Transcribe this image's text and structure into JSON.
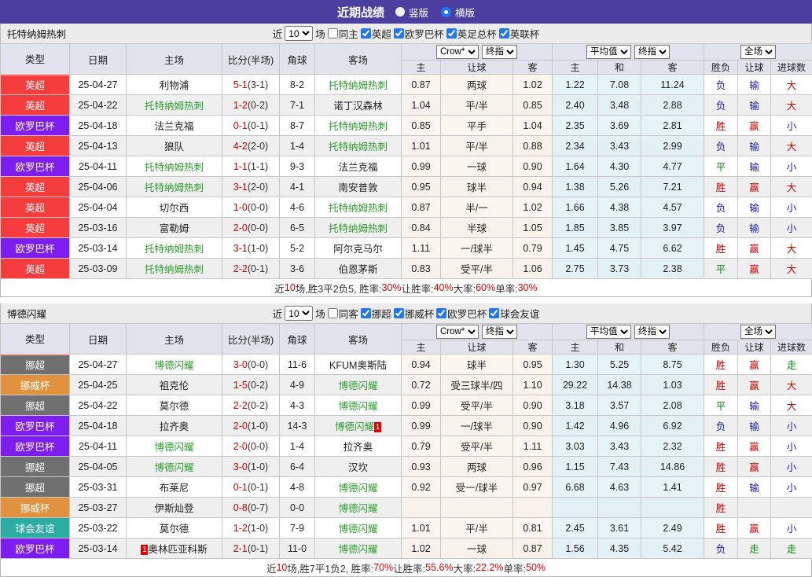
{
  "title_bar": {
    "title": "近期战绩",
    "options": [
      {
        "label": "竖版",
        "selected": false
      },
      {
        "label": "横版",
        "selected": true
      }
    ]
  },
  "columns": {
    "type": "类型",
    "date": "日期",
    "home": "主场",
    "score": "比分(半场)",
    "corner": "角球",
    "away": "客场",
    "bookmaker_select": "Crow*",
    "final_select": "终指",
    "avg_select": "平均值",
    "scope_select": "全场",
    "odds_home": "主",
    "odds_line": "让球",
    "odds_away": "客",
    "avg_home": "主",
    "avg_draw": "和",
    "avg_away": "客",
    "result_wl": "胜负",
    "result_handicap": "让球",
    "result_goals": "进球数"
  },
  "league_colors": {
    "英超": "#f53d3d",
    "欧罗巴杯": "#7d1df0",
    "挪超": "#707070",
    "挪威杯": "#e0923f",
    "球会友谊": "#2bada2"
  },
  "outcome_colors": {
    "胜": "#d40000",
    "负": "#1a1ab8",
    "平": "#0a8a0a",
    "赢": "#d40000",
    "输": "#1a1ab8",
    "走": "#0a8a0a",
    "大": "#d40000",
    "小": "#1a1ab8"
  },
  "sections": [
    {
      "team": "托特纳姆热刺",
      "filter": {
        "near_label": "近",
        "games_value": "10",
        "games_label": "场",
        "same_label": "同主",
        "same_checked": false,
        "leagues": [
          {
            "label": "英超",
            "checked": true
          },
          {
            "label": "欧罗巴杯",
            "checked": true
          },
          {
            "label": "英足总杯",
            "checked": true
          },
          {
            "label": "英联杯",
            "checked": true
          }
        ]
      },
      "rows": [
        {
          "type": "英超",
          "date": "25-04-27",
          "home": {
            "name": "利物浦",
            "self": false
          },
          "score": "5-1",
          "half": "(3-1)",
          "corner": "8-2",
          "away": {
            "name": "托特纳姆热刺",
            "self": true
          },
          "odds": [
            "0.87",
            "两球",
            "1.02"
          ],
          "avg": [
            "1.22",
            "7.08",
            "11.24"
          ],
          "results": [
            "负",
            "输",
            "大"
          ]
        },
        {
          "type": "英超",
          "date": "25-04-22",
          "home": {
            "name": "托特纳姆热刺",
            "self": true
          },
          "score": "1-2",
          "half": "(0-2)",
          "corner": "7-1",
          "away": {
            "name": "诺丁汉森林",
            "self": false
          },
          "odds": [
            "1.04",
            "平/半",
            "0.85"
          ],
          "avg": [
            "2.40",
            "3.48",
            "2.88"
          ],
          "results": [
            "负",
            "输",
            "大"
          ]
        },
        {
          "type": "欧罗巴杯",
          "date": "25-04-18",
          "home": {
            "name": "法兰克福",
            "self": false
          },
          "score": "0-1",
          "half": "(0-1)",
          "corner": "8-7",
          "away": {
            "name": "托特纳姆热刺",
            "self": true
          },
          "odds": [
            "0.85",
            "平手",
            "1.04"
          ],
          "avg": [
            "2.35",
            "3.69",
            "2.81"
          ],
          "results": [
            "胜",
            "赢",
            "小"
          ]
        },
        {
          "type": "英超",
          "date": "25-04-13",
          "home": {
            "name": "狼队",
            "self": false
          },
          "score": "4-2",
          "half": "(2-0)",
          "corner": "1-4",
          "away": {
            "name": "托特纳姆热刺",
            "self": true
          },
          "odds": [
            "1.01",
            "平/半",
            "0.88"
          ],
          "avg": [
            "2.34",
            "3.43",
            "2.99"
          ],
          "results": [
            "负",
            "输",
            "大"
          ]
        },
        {
          "type": "欧罗巴杯",
          "date": "25-04-11",
          "home": {
            "name": "托特纳姆热刺",
            "self": true
          },
          "score": "1-1",
          "half": "(1-1)",
          "corner": "9-3",
          "away": {
            "name": "法兰克福",
            "self": false
          },
          "odds": [
            "0.99",
            "一球",
            "0.90"
          ],
          "avg": [
            "1.64",
            "4.30",
            "4.77"
          ],
          "results": [
            "平",
            "输",
            "小"
          ]
        },
        {
          "type": "英超",
          "date": "25-04-06",
          "home": {
            "name": "托特纳姆热刺",
            "self": true
          },
          "score": "3-1",
          "half": "(2-0)",
          "corner": "4-1",
          "away": {
            "name": "南安普敦",
            "self": false
          },
          "odds": [
            "0.95",
            "球半",
            "0.94"
          ],
          "avg": [
            "1.38",
            "5.26",
            "7.21"
          ],
          "results": [
            "胜",
            "赢",
            "大"
          ]
        },
        {
          "type": "英超",
          "date": "25-04-04",
          "home": {
            "name": "切尔西",
            "self": false
          },
          "score": "1-0",
          "half": "(0-0)",
          "corner": "4-6",
          "away": {
            "name": "托特纳姆热刺",
            "self": true
          },
          "odds": [
            "0.87",
            "半/一",
            "1.02"
          ],
          "avg": [
            "1.66",
            "4.38",
            "4.57"
          ],
          "results": [
            "负",
            "输",
            "小"
          ]
        },
        {
          "type": "英超",
          "date": "25-03-16",
          "home": {
            "name": "富勒姆",
            "self": false
          },
          "score": "2-0",
          "half": "(0-0)",
          "corner": "6-5",
          "away": {
            "name": "托特纳姆热刺",
            "self": true
          },
          "odds": [
            "0.84",
            "半球",
            "1.05"
          ],
          "avg": [
            "1.85",
            "3.85",
            "3.97"
          ],
          "results": [
            "负",
            "输",
            "小"
          ]
        },
        {
          "type": "欧罗巴杯",
          "date": "25-03-14",
          "home": {
            "name": "托特纳姆热刺",
            "self": true
          },
          "score": "3-1",
          "half": "(1-0)",
          "corner": "5-2",
          "away": {
            "name": "阿尔克马尔",
            "self": false
          },
          "odds": [
            "1.11",
            "一/球半",
            "0.79"
          ],
          "avg": [
            "1.45",
            "4.75",
            "6.62"
          ],
          "results": [
            "胜",
            "赢",
            "大"
          ]
        },
        {
          "type": "英超",
          "date": "25-03-09",
          "home": {
            "name": "托特纳姆热刺",
            "self": true
          },
          "score": "2-2",
          "half": "(0-1)",
          "corner": "3-6",
          "away": {
            "name": "伯恩茅斯",
            "self": false
          },
          "odds": [
            "0.83",
            "受平/半",
            "1.06"
          ],
          "avg": [
            "2.75",
            "3.73",
            "2.38"
          ],
          "results": [
            "平",
            "赢",
            "大"
          ]
        }
      ],
      "summary": [
        "近",
        "10",
        "场,胜3平2负5, 胜率:",
        "30%",
        " 让胜率:",
        "40%",
        " 大率:",
        "60%",
        " 单率:",
        "30%"
      ]
    },
    {
      "team": "博德闪耀",
      "filter": {
        "near_label": "近",
        "games_value": "10",
        "games_label": "场",
        "same_label": "同客",
        "same_checked": false,
        "leagues": [
          {
            "label": "挪超",
            "checked": true
          },
          {
            "label": "挪威杯",
            "checked": true
          },
          {
            "label": "欧罗巴杯",
            "checked": true
          },
          {
            "label": "球会友谊",
            "checked": true
          }
        ]
      },
      "rows": [
        {
          "type": "挪超",
          "date": "25-04-27",
          "home": {
            "name": "博德闪耀",
            "self": true
          },
          "score": "3-0",
          "half": "(0-0)",
          "corner": "11-6",
          "away": {
            "name": "KFUM奥斯陆",
            "self": false
          },
          "odds": [
            "0.94",
            "球半",
            "0.95"
          ],
          "avg": [
            "1.30",
            "5.25",
            "8.75"
          ],
          "results": [
            "胜",
            "赢",
            "走"
          ]
        },
        {
          "type": "挪威杯",
          "date": "25-04-25",
          "home": {
            "name": "祖克伦",
            "self": false
          },
          "score": "1-5",
          "half": "(0-2)",
          "corner": "4-9",
          "away": {
            "name": "博德闪耀",
            "self": true
          },
          "odds": [
            "0.72",
            "受三球半/四",
            "1.10"
          ],
          "avg": [
            "29.22",
            "14.38",
            "1.03"
          ],
          "results": [
            "胜",
            "赢",
            "大"
          ]
        },
        {
          "type": "挪超",
          "date": "25-04-22",
          "home": {
            "name": "莫尔德",
            "self": false
          },
          "score": "2-2",
          "half": "(0-2)",
          "corner": "4-3",
          "away": {
            "name": "博德闪耀",
            "self": true
          },
          "odds": [
            "0.99",
            "受平/半",
            "0.90"
          ],
          "avg": [
            "3.18",
            "3.57",
            "2.08"
          ],
          "results": [
            "平",
            "输",
            "大"
          ]
        },
        {
          "type": "欧罗巴杯",
          "date": "25-04-18",
          "home": {
            "name": "拉齐奥",
            "self": false
          },
          "score": "2-0",
          "half": "(1-0)",
          "corner": "14-3",
          "away": {
            "name": "博德闪耀",
            "self": true,
            "badge_after": "1"
          },
          "odds": [
            "0.99",
            "一/球半",
            "0.90"
          ],
          "avg": [
            "1.42",
            "4.96",
            "6.92"
          ],
          "results": [
            "负",
            "输",
            "小"
          ]
        },
        {
          "type": "欧罗巴杯",
          "date": "25-04-11",
          "home": {
            "name": "博德闪耀",
            "self": true
          },
          "score": "2-0",
          "half": "(0-0)",
          "corner": "1-4",
          "away": {
            "name": "拉齐奥",
            "self": false
          },
          "odds": [
            "0.79",
            "受平/半",
            "1.11"
          ],
          "avg": [
            "3.03",
            "3.43",
            "2.32"
          ],
          "results": [
            "胜",
            "赢",
            "小"
          ]
        },
        {
          "type": "挪超",
          "date": "25-04-05",
          "home": {
            "name": "博德闪耀",
            "self": true
          },
          "score": "3-0",
          "half": "(1-0)",
          "corner": "6-4",
          "away": {
            "name": "汉坎",
            "self": false
          },
          "odds": [
            "0.93",
            "两球",
            "0.96"
          ],
          "avg": [
            "1.15",
            "7.43",
            "14.86"
          ],
          "results": [
            "胜",
            "赢",
            "小"
          ]
        },
        {
          "type": "挪超",
          "date": "25-03-31",
          "home": {
            "name": "布莱尼",
            "self": false
          },
          "score": "0-1",
          "half": "(0-1)",
          "corner": "4-8",
          "away": {
            "name": "博德闪耀",
            "self": true
          },
          "odds": [
            "0.92",
            "受一/球半",
            "0.97"
          ],
          "avg": [
            "6.68",
            "4.63",
            "1.41"
          ],
          "results": [
            "胜",
            "输",
            "小"
          ]
        },
        {
          "type": "挪威杯",
          "date": "25-03-27",
          "home": {
            "name": "伊斯灿登",
            "self": false
          },
          "score": "0-8",
          "half": "(0-7)",
          "corner": "0-0",
          "away": {
            "name": "博德闪耀",
            "self": true
          },
          "odds": [
            "",
            "",
            ""
          ],
          "avg": [
            "",
            "",
            ""
          ],
          "results": [
            "胜",
            "",
            ""
          ]
        },
        {
          "type": "球会友谊",
          "date": "25-03-22",
          "home": {
            "name": "莫尔德",
            "self": false
          },
          "score": "1-2",
          "half": "(1-0)",
          "corner": "7-9",
          "away": {
            "name": "博德闪耀",
            "self": true
          },
          "odds": [
            "1.01",
            "平/半",
            "0.81"
          ],
          "avg": [
            "2.45",
            "3.61",
            "2.49"
          ],
          "results": [
            "胜",
            "赢",
            "小"
          ]
        },
        {
          "type": "欧罗巴杯",
          "date": "25-03-14",
          "home": {
            "name": "奥林匹亚科斯",
            "self": false,
            "badge_before": "1"
          },
          "score": "2-1",
          "half": "(0-1)",
          "corner": "11-0",
          "away": {
            "name": "博德闪耀",
            "self": true
          },
          "odds": [
            "1.02",
            "一球",
            "0.87"
          ],
          "avg": [
            "1.56",
            "4.35",
            "5.42"
          ],
          "results": [
            "负",
            "走",
            "走"
          ]
        }
      ],
      "summary": [
        "近",
        "10",
        "场,胜7平1负2, 胜率:",
        "70%",
        " 让胜率:",
        "55.6%",
        " 大率:",
        "22.2%",
        " 单率:",
        "50%"
      ]
    }
  ]
}
